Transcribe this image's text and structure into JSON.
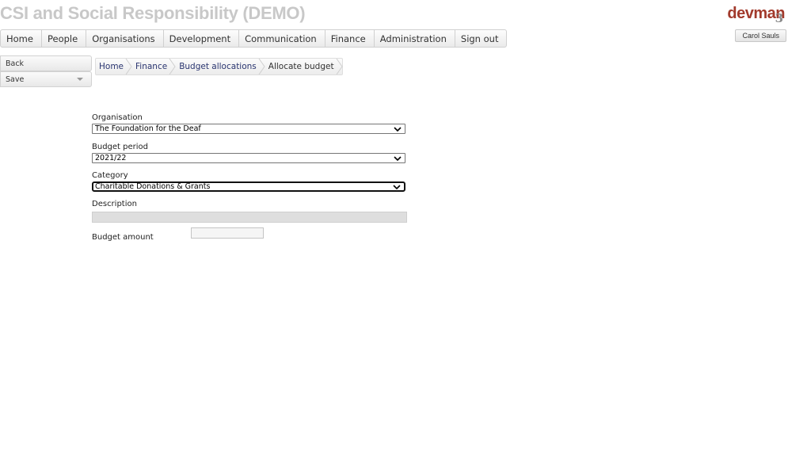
{
  "app": {
    "title": "CSI and Social Responsibility (DEMO)",
    "logo_text": "devman",
    "logo_mark": "3"
  },
  "user": {
    "name": "Carol Sauls"
  },
  "nav": {
    "items": [
      {
        "label": "Home"
      },
      {
        "label": "People"
      },
      {
        "label": "Organisations"
      },
      {
        "label": "Development"
      },
      {
        "label": "Communication"
      },
      {
        "label": "Finance"
      },
      {
        "label": "Administration"
      },
      {
        "label": "Sign out"
      }
    ]
  },
  "actions": {
    "back_label": "Back",
    "save_label": "Save"
  },
  "breadcrumb": {
    "items": [
      {
        "label": "Home"
      },
      {
        "label": "Finance"
      },
      {
        "label": "Budget allocations"
      },
      {
        "label": "Allocate budget"
      }
    ]
  },
  "form": {
    "organisation": {
      "label": "Organisation",
      "value": "The Foundation for the Deaf"
    },
    "budget_period": {
      "label": "Budget period",
      "value": "2021/22"
    },
    "category": {
      "label": "Category",
      "value": "Charitable Donations & Grants"
    },
    "description": {
      "label": "Description",
      "value": ""
    },
    "budget_amount": {
      "label": "Budget amount",
      "value": ""
    }
  },
  "colors": {
    "title": "#c8c8c8",
    "logo": "#a23a2c",
    "link": "#2a3570"
  }
}
